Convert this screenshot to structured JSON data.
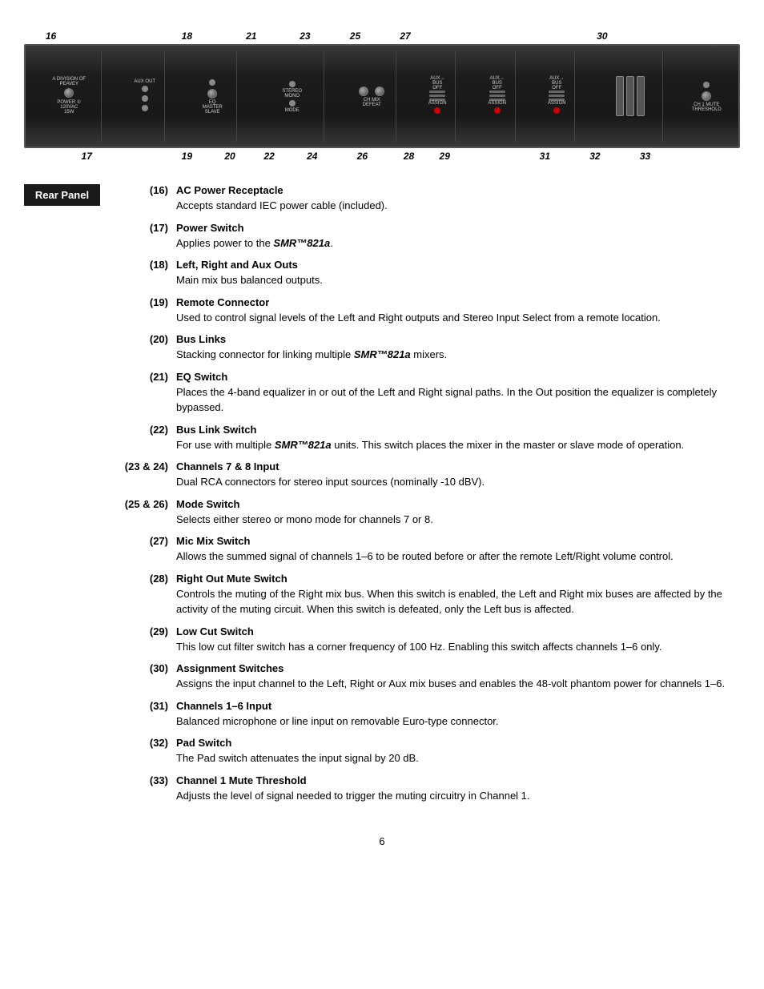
{
  "diagram": {
    "top_numbers": [
      {
        "id": "16",
        "left": "3.5%"
      },
      {
        "id": "18",
        "left": "22%"
      },
      {
        "id": "21",
        "left": "32%"
      },
      {
        "id": "23",
        "left": "39%"
      },
      {
        "id": "25",
        "left": "46%"
      },
      {
        "id": "27",
        "left": "53%"
      },
      {
        "id": "30",
        "left": "80%"
      }
    ],
    "bottom_numbers": [
      {
        "id": "17",
        "left": "8%"
      },
      {
        "id": "19",
        "left": "22%"
      },
      {
        "id": "20",
        "left": "28%"
      },
      {
        "id": "22",
        "left": "34%"
      },
      {
        "id": "24",
        "left": "40%"
      },
      {
        "id": "26",
        "left": "47%"
      },
      {
        "id": "28",
        "left": "53%"
      },
      {
        "id": "29",
        "left": "58%"
      },
      {
        "id": "31",
        "left": "72%"
      },
      {
        "id": "32",
        "left": "80%"
      },
      {
        "id": "33",
        "left": "87%"
      }
    ]
  },
  "sidebar": {
    "rear_panel_label": "Rear Panel"
  },
  "items": [
    {
      "number": "(16)",
      "title": "AC Power Receptacle",
      "description": "Accepts standard IEC power cable (included)."
    },
    {
      "number": "(17)",
      "title": "Power Switch",
      "description": "Applies power to the SMR™821a."
    },
    {
      "number": "(18)",
      "title": "Left, Right and Aux Outs",
      "description": "Main mix bus balanced outputs."
    },
    {
      "number": "(19)",
      "title": "Remote Connector",
      "description": "Used to control signal levels of the Left and Right outputs and Stereo Input Select from a remote location."
    },
    {
      "number": "(20)",
      "title": "Bus Links",
      "description": "Stacking connector for linking multiple SMR™821a mixers."
    },
    {
      "number": "(21)",
      "title": "EQ Switch",
      "description": "Places the 4-band equalizer in or out of the Left and Right signal paths. In the Out position the equalizer is completely bypassed."
    },
    {
      "number": "(22)",
      "title": "Bus Link Switch",
      "description": "For use with multiple SMR™821a units. This switch places the mixer in the master or slave mode of operation."
    },
    {
      "number": "(23 & 24)",
      "title": "Channels 7 & 8 Input",
      "description": "Dual RCA connectors for stereo input sources (nominally -10 dBV)."
    },
    {
      "number": "(25 & 26)",
      "title": "Mode Switch",
      "description": "Selects either stereo or mono mode for channels 7 or 8."
    },
    {
      "number": "(27)",
      "title": "Mic Mix Switch",
      "description": "Allows the summed signal of channels 1–6 to be routed before or after the remote Left/Right volume control."
    },
    {
      "number": "(28)",
      "title": "Right Out Mute Switch",
      "description": "Controls the muting of the Right mix bus. When this switch is enabled, the Left and Right mix buses are affected by the activity of the muting circuit. When this switch is defeated, only the Left bus is affected."
    },
    {
      "number": "(29)",
      "title": "Low Cut Switch",
      "description": "This low cut filter switch has a corner frequency of 100 Hz. Enabling this switch affects channels 1–6 only."
    },
    {
      "number": "(30)",
      "title": "Assignment Switches",
      "description": "Assigns the input channel to the Left, Right or Aux mix buses and enables the 48-volt phantom power for channels 1–6."
    },
    {
      "number": "(31)",
      "title": "Channels 1–6 Input",
      "description": "Balanced microphone or line input on removable Euro-type connector."
    },
    {
      "number": "(32)",
      "title": "Pad Switch",
      "description": "The Pad switch attenuates the input signal by 20 dB."
    },
    {
      "number": "(33)",
      "title": "Channel 1 Mute Threshold",
      "description": "Adjusts the level of signal needed to trigger the muting circuitry in Channel 1."
    }
  ],
  "page_number": "6"
}
